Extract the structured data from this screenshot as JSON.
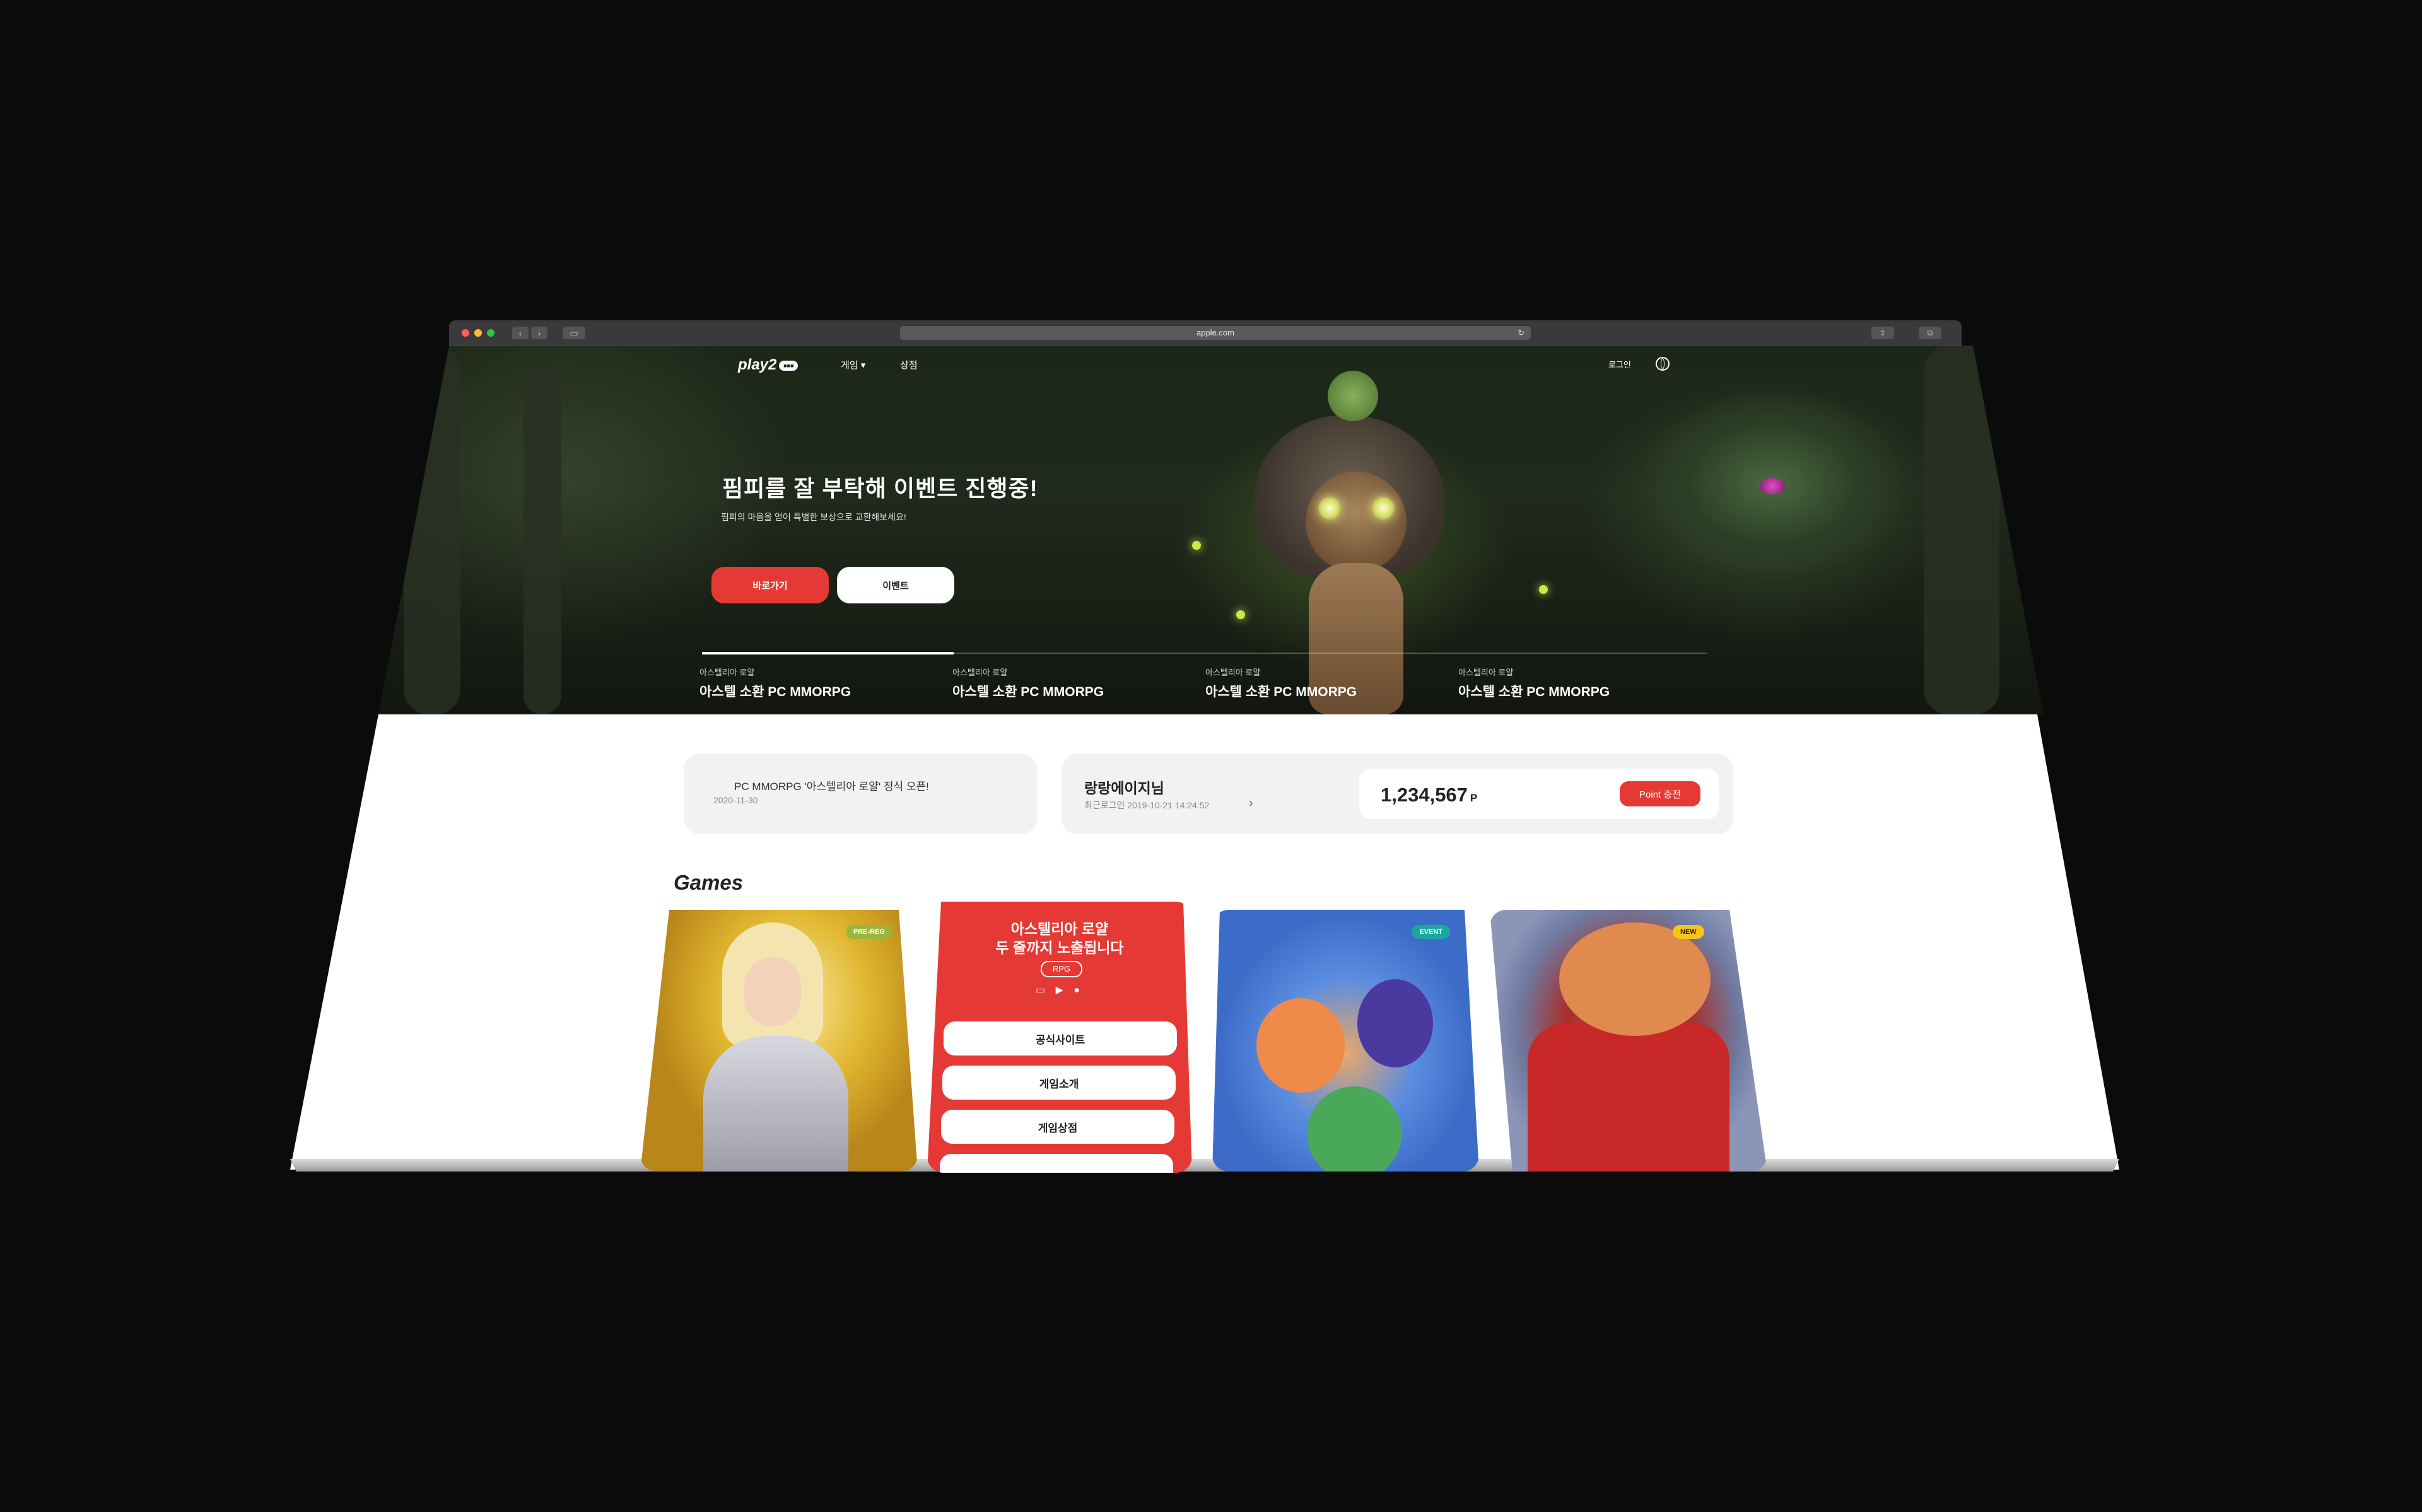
{
  "browser": {
    "url": "apple.com",
    "back_glyph": "‹",
    "forward_glyph": "›",
    "reload_glyph": "↻"
  },
  "site": {
    "logo": "play2",
    "logo_badge": "■■■",
    "nav": [
      "게임 ▾",
      "상점"
    ],
    "login": "로그인"
  },
  "hero": {
    "title": "핌피를 잘 부탁해 이벤트 진행중!",
    "subtitle": "핌피의 마음을 얻어 특별한 보상으로 교환해보세요!",
    "primary_button": "바로가기",
    "secondary_button": "이벤트",
    "progress": 0.25,
    "slides": [
      {
        "sub": "아스텔리아 로얄",
        "title": "아스텔 소환 PC MMORPG"
      },
      {
        "sub": "아스텔리아 로얄",
        "title": "아스텔 소환 PC MMORPG"
      },
      {
        "sub": "아스텔리아 로얄",
        "title": "아스텔 소환 PC MMORPG"
      },
      {
        "sub": "아스텔리아 로얄",
        "title": "아스텔 소환 PC MMORPG"
      }
    ]
  },
  "notice": {
    "title": "PC MMORPG '아스텔리아 로얄' 정식 오픈!",
    "date": "2020-11-30"
  },
  "user": {
    "name": "랑랑에이지님",
    "last_login": "최근로그인   2019-10-21 14:24:52",
    "chevron": "›",
    "points": "1,234,567",
    "points_unit": "P",
    "charge_button": "Point 충전"
  },
  "games": {
    "heading": "Games",
    "cards": [
      {
        "badge": "PRE-REG"
      },
      {
        "title_line1": "아스텔리아 로얄",
        "title_line2": "두 줄까지 노출됩니다",
        "genre": "RPG",
        "platforms": "▭ ▶ ●",
        "buttons": [
          "공식사이트",
          "게임소개",
          "게임상점",
          ""
        ]
      },
      {
        "badge": "EVENT"
      },
      {
        "badge": "NEW"
      }
    ]
  },
  "colors": {
    "accent": "#e53935",
    "background": "#0b0b0b"
  }
}
